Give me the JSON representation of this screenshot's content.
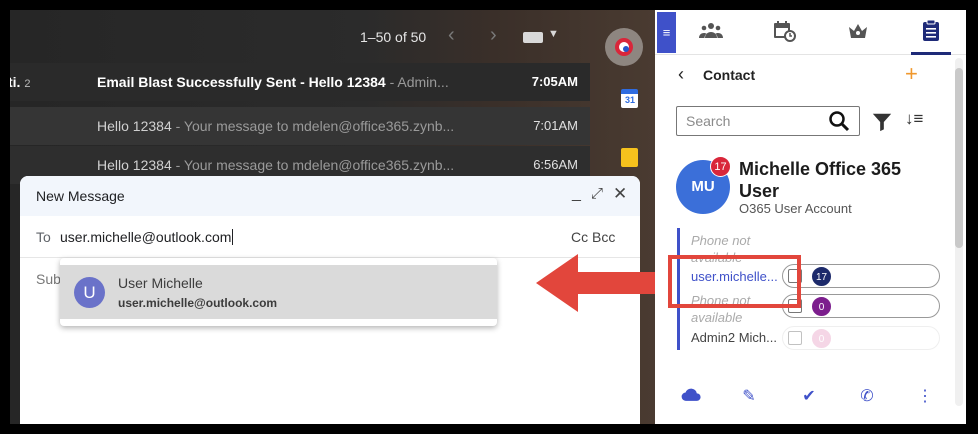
{
  "gmail": {
    "range": "1–50 of 50",
    "rows": [
      {
        "sender": "ti.",
        "count": "2",
        "subject": "Email Blast Successfully Sent - Hello 12384",
        "snippet": " - Admin...",
        "time": "7:05AM"
      },
      {
        "subject": "Hello 12384",
        "snippet": " - Your message to mdelen@office365.zynb...",
        "time": "7:01AM"
      },
      {
        "subject": "Hello 12384",
        "snippet": " - Your message to mdelen@office365.zynb...",
        "time": "6:56AM"
      }
    ]
  },
  "compose": {
    "title": "New Message",
    "to_label": "To",
    "to_value": "user.michelle@outlook.com",
    "cc_bcc": "Cc Bcc",
    "subject_label": "Sub",
    "suggestion": {
      "initial": "U",
      "name": "User Michelle",
      "email": "user.michelle@outlook.com"
    }
  },
  "panel": {
    "header_title": "Contact",
    "search_placeholder": "Search",
    "contact": {
      "initials": "MU",
      "badge": "17",
      "name": "Michelle Office 365 User",
      "subtitle": "O365 User Account"
    },
    "details": {
      "phone1": "Phone not available",
      "email1": "user.michelle...",
      "phone2": "Phone not available",
      "email2": "Admin2 Mich..."
    },
    "pills": [
      {
        "badge": "17"
      },
      {
        "badge": "0"
      },
      {
        "badge": "0"
      }
    ]
  },
  "colors": {
    "accent": "#3f51c9",
    "arrow": "#e2463c",
    "add": "#f0982d"
  },
  "icons": {
    "toolbar": [
      "menu-icon",
      "people-icon",
      "calendar-icon",
      "crown-icon",
      "clipboard-icon"
    ],
    "footer": [
      "cloud-icon",
      "edit-icon",
      "check-icon",
      "phone-icon",
      "more-icon"
    ]
  }
}
